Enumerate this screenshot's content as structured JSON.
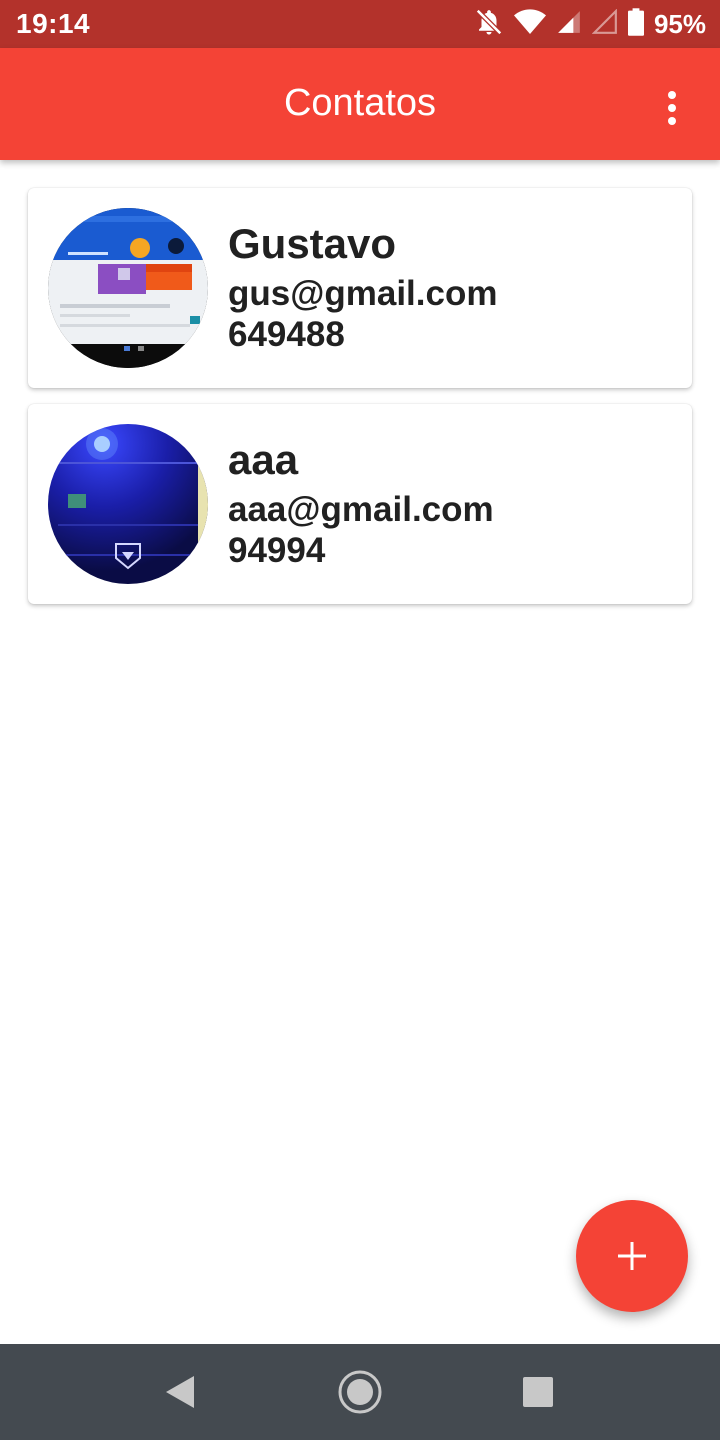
{
  "status_bar": {
    "time": "19:14",
    "battery_percent": "95%",
    "icons": [
      "bell-off-icon",
      "wifi-icon",
      "signal-icon",
      "signal-empty-icon",
      "battery-icon"
    ]
  },
  "app_bar": {
    "title": "Contatos",
    "menu_icon": "more-vert-icon"
  },
  "contacts": [
    {
      "name": "Gustavo",
      "email": "gus@gmail.com",
      "phone": "649488"
    },
    {
      "name": "aaa",
      "email": "aaa@gmail.com",
      "phone": "94994"
    }
  ],
  "fab": {
    "icon": "plus-icon"
  },
  "nav_bar": {
    "icons": [
      "back-icon",
      "home-icon",
      "recents-icon"
    ]
  },
  "colors": {
    "primary": "#f44336",
    "primary_dark": "#b3322b",
    "nav_bar": "#444a50",
    "text": "#212121"
  }
}
